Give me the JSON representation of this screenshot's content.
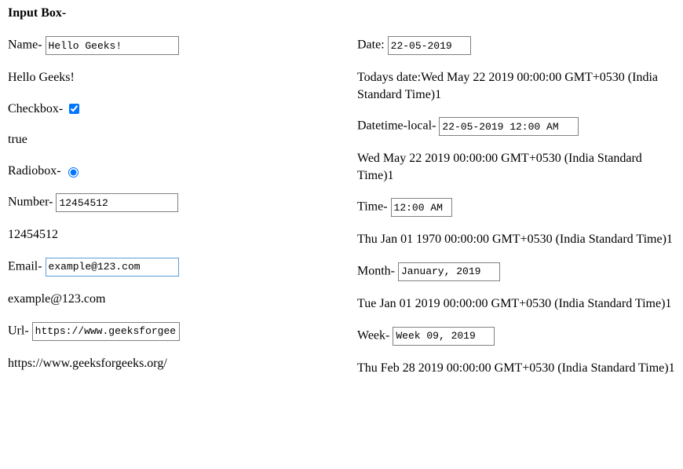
{
  "heading": "Input Box-",
  "left": {
    "name": {
      "label": "Name- ",
      "value": "Hello Geeks!",
      "output": "Hello Geeks!"
    },
    "checkbox": {
      "label": "Checkbox- ",
      "checked": true,
      "output": "true"
    },
    "radio": {
      "label": "Radiobox- ",
      "checked": true
    },
    "number": {
      "label": "Number- ",
      "value": "12454512",
      "output": "12454512"
    },
    "email": {
      "label": "Email- ",
      "value": "example@123.com",
      "output": "example@123.com"
    },
    "url": {
      "label": "Url- ",
      "value": "https://www.geeksforgeeks.o",
      "output": "https://www.geeksforgeeks.org/"
    }
  },
  "right": {
    "date": {
      "label": "Date: ",
      "value": "22-05-2019",
      "output_prefix": "Todays date:",
      "output": "Wed May 22 2019 00:00:00 GMT+0530 (India Standard Time)1"
    },
    "datetime": {
      "label": "Datetime-local- ",
      "value": "22-05-2019 12:00 AM",
      "output": "Wed May 22 2019 00:00:00 GMT+0530 (India Standard Time)1"
    },
    "time": {
      "label": "Time- ",
      "value": "12:00 AM",
      "output": "Thu Jan 01 1970 00:00:00 GMT+0530 (India Standard Time)1"
    },
    "month": {
      "label": "Month- ",
      "value": "January, 2019",
      "output": "Tue Jan 01 2019 00:00:00 GMT+0530 (India Standard Time)1"
    },
    "week": {
      "label": "Week- ",
      "value": "Week 09, 2019",
      "output": "Thu Feb 28 2019 00:00:00 GMT+0530 (India Standard Time)1"
    }
  }
}
